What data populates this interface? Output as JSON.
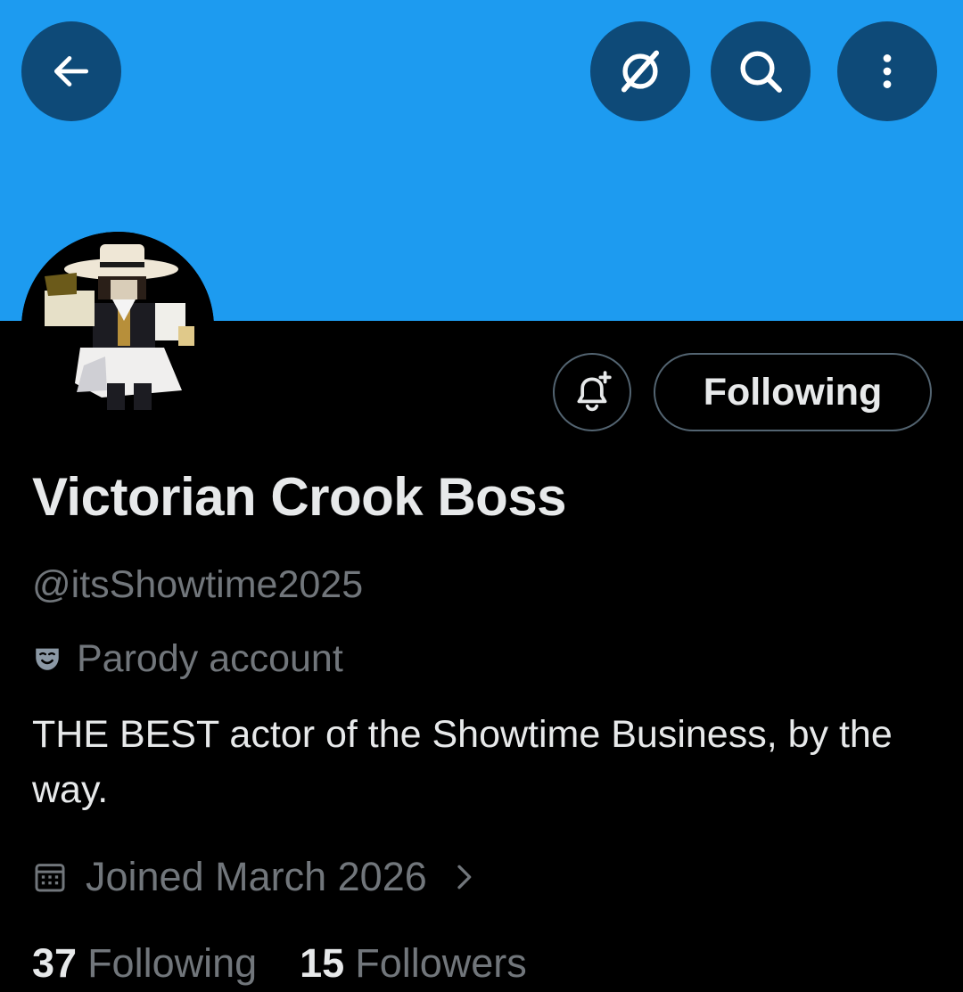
{
  "header": {
    "back_icon": "arrow-left-icon",
    "grok_icon": "grok-icon",
    "search_icon": "search-icon",
    "more_icon": "more-vertical-icon",
    "banner_color": "#1d9bf0",
    "button_color": "#0e4a78"
  },
  "profile": {
    "display_name": "Victorian Crook Boss",
    "handle": "@itsShowtime2025",
    "label_icon": "parody-mask-icon",
    "label": "Parody account",
    "bio": "THE BEST actor of the Showtime Business, by the way.",
    "joined_icon": "calendar-icon",
    "joined": "Joined March 2026"
  },
  "actions": {
    "notify_icon": "bell-plus-icon",
    "following_label": "Following"
  },
  "stats": {
    "following_count": "37",
    "following_label": "Following",
    "followers_count": "15",
    "followers_label": "Followers"
  }
}
